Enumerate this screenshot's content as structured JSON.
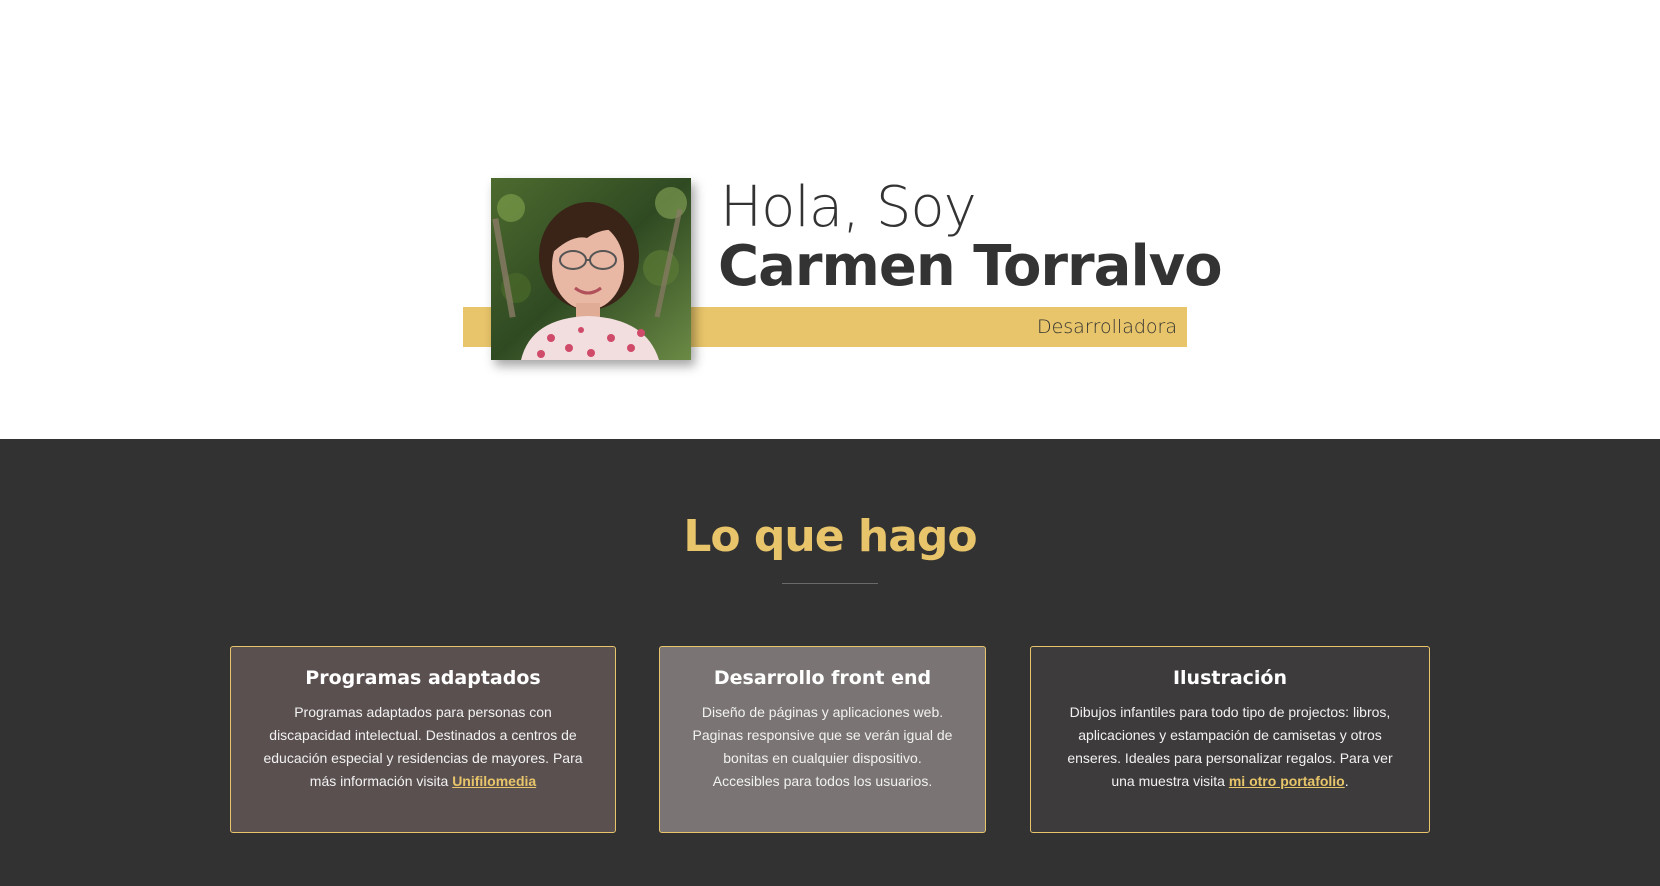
{
  "header": {
    "logo_icon": "ct-monogram-icon",
    "menu_icon": "hamburger-menu-icon"
  },
  "hero": {
    "greeting": "Hola, Soy",
    "name": "Carmen Torralvo",
    "role": "Desarrolladora",
    "photo_icon": "profile-photo"
  },
  "services": {
    "title": "Lo que hago",
    "cards": [
      {
        "title": "Programas adaptados",
        "text": "Programas adaptados para personas con discapacidad intelectual. Destinados a centros de educación especial y residencias de mayores. Para más información visita ",
        "link_text": "Unifilomedia",
        "text_after": ""
      },
      {
        "title": "Desarrollo front end",
        "text": "Diseño de páginas y aplicaciones web. Paginas responsive que se verán igual de bonitas en cualquier dispositivo. Accesibles para todos los usuarios.",
        "link_text": "",
        "text_after": ""
      },
      {
        "title": "Ilustración",
        "text": "Dibujos infantiles para todo tipo de projectos: libros, aplicaciones y estampación de camisetas y otros enseres. Ideales para personalizar regalos. Para ver una muestra visita ",
        "link_text": "mi otro portafolio",
        "text_after": "."
      }
    ]
  },
  "colors": {
    "accent": "#e8c56a",
    "dark_bg": "#333232",
    "text_dark": "#333333"
  }
}
